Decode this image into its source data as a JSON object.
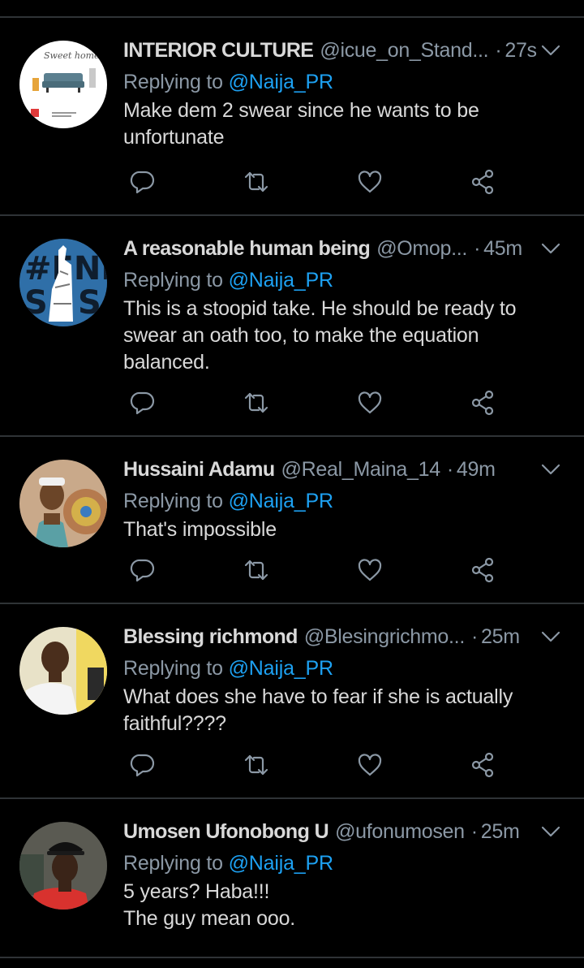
{
  "colors": {
    "background": "#000000",
    "divider": "#2f3336",
    "primary_text": "#d9d9d9",
    "secondary_text": "#8b98a5",
    "accent": "#1da1f2"
  },
  "icons": {
    "reply": "reply-icon",
    "retweet": "retweet-icon",
    "like": "like-icon",
    "share": "share-icon",
    "more": "chevron-down-icon"
  },
  "replying_prefix": "Replying to",
  "tweets": [
    {
      "name": "INTERIOR CULTURE",
      "handle": "@icue_on_Stand...",
      "time": "27s",
      "replying_to": "@Naija_PR",
      "text": "Make dem 2 swear since he wants to be\nunfortunate"
    },
    {
      "name": "A reasonable human being",
      "handle": "@Omop...",
      "time": "45m",
      "replying_to": "@Naija_PR",
      "text": "This is a stoopid take. He should be ready to\nswear an oath too, to make the equation\nbalanced."
    },
    {
      "name": "Hussaini Adamu",
      "handle": "@Real_Maina_14",
      "time": "49m",
      "replying_to": "@Naija_PR",
      "text": "That's impossible"
    },
    {
      "name": "Blessing richmond",
      "handle": "@Blesingrichmo...",
      "time": "25m",
      "replying_to": "@Naija_PR",
      "text": "What does she have to fear if she is actually\nfaithful????"
    },
    {
      "name": "Umosen Ufonobong U",
      "handle": "@ufonumosen",
      "time": "25m",
      "replying_to": "@Naija_PR",
      "text": "5 years? Haba!!!\nThe guy mean ooo."
    }
  ]
}
